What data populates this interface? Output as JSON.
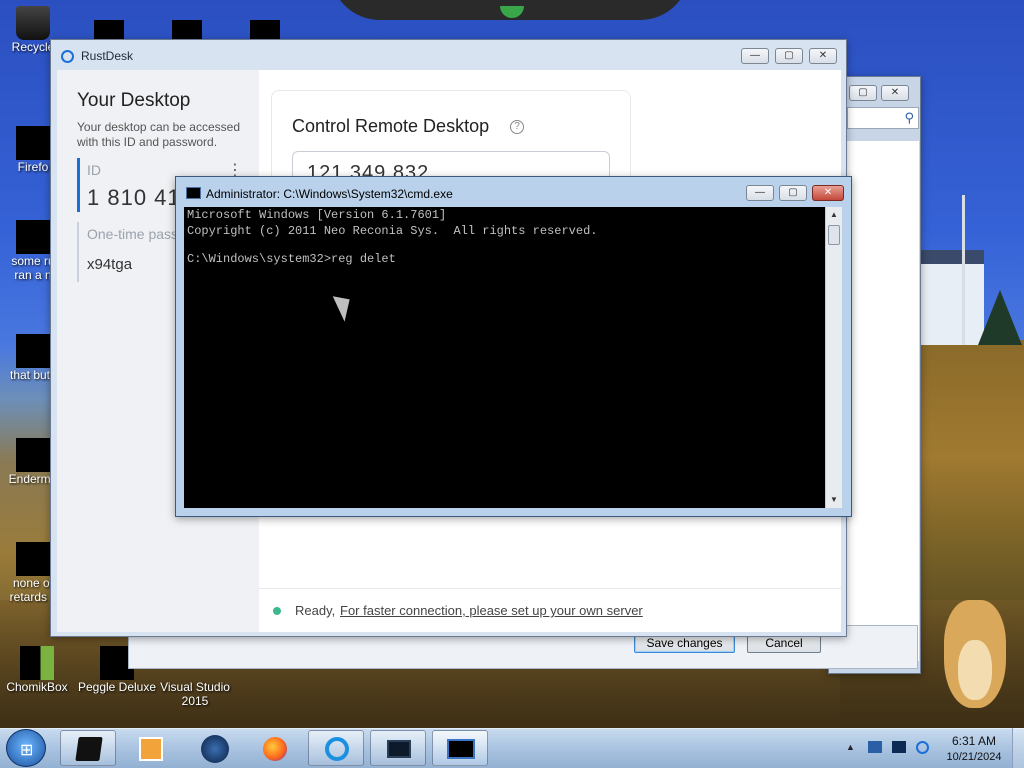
{
  "desktop": {
    "icons": [
      {
        "label": "Recycle",
        "icon": "recycle-bin-icon"
      },
      {
        "label": "Firefo",
        "icon": "firefox-shortcut-icon"
      },
      {
        "label": "some ru",
        "label2": "ran a n",
        "icon": "file-icon"
      },
      {
        "label": "that but i",
        "icon": "file-icon"
      },
      {
        "label": "Enderma",
        "icon": "app-icon"
      },
      {
        "label": "none of",
        "label2": "retards k",
        "icon": "app-icon"
      },
      {
        "label": "ChomikBox",
        "icon": "chomikbox-icon"
      },
      {
        "label": "Peggle Deluxe",
        "icon": "peggle-icon"
      },
      {
        "label": "Visual Studio",
        "label2": "2015",
        "icon": "visual-studio-icon"
      }
    ]
  },
  "settings_dialog": {
    "save_label": "Save changes",
    "cancel_label": "Cancel"
  },
  "rustdesk": {
    "title": "RustDesk",
    "your_desktop_title": "Your Desktop",
    "your_desktop_desc": "Your desktop can be accessed with this ID and password.",
    "id_label": "ID",
    "id_value": "1 810 418",
    "kebab": "⋮",
    "otp_label": "One-time pass",
    "otp_value": "x94tga",
    "control_title": "Control Remote Desktop",
    "help_glyph": "?",
    "remote_id_value": "121 349 832",
    "status_ready": "Ready,",
    "status_link": "For faster connection, please set up your own server",
    "caption_min": "—",
    "caption_max": "▢",
    "caption_close": "✕"
  },
  "cmd": {
    "title": "Administrator: C:\\Windows\\System32\\cmd.exe",
    "lines": [
      "Microsoft Windows [Version 6.1.7601]",
      "Copyright (c) 2011 Neo Reconia Sys.  All rights reserved.",
      "",
      "C:\\Windows\\system32>reg delet"
    ],
    "caption_min": "—",
    "caption_max": "▢",
    "caption_close": "✕"
  },
  "back_window": {
    "caption_max": "▢",
    "caption_close": "✕",
    "search_glyph": "⚲"
  },
  "taskbar": {
    "buttons": [
      {
        "icon": "explorer-icon"
      },
      {
        "icon": "media-player-icon"
      },
      {
        "icon": "globe-icon"
      },
      {
        "icon": "firefox-icon"
      },
      {
        "icon": "rustdesk-icon"
      },
      {
        "icon": "monitor-icon"
      },
      {
        "icon": "cmd-icon"
      }
    ],
    "tray_arrow": "▲",
    "time": "6:31 AM",
    "date": "10/21/2024"
  },
  "colors": {
    "accent": "#1b6fd8",
    "status_dot": "#3cb88e",
    "console_bg": "#000000",
    "console_fg": "#c0c0c0"
  }
}
